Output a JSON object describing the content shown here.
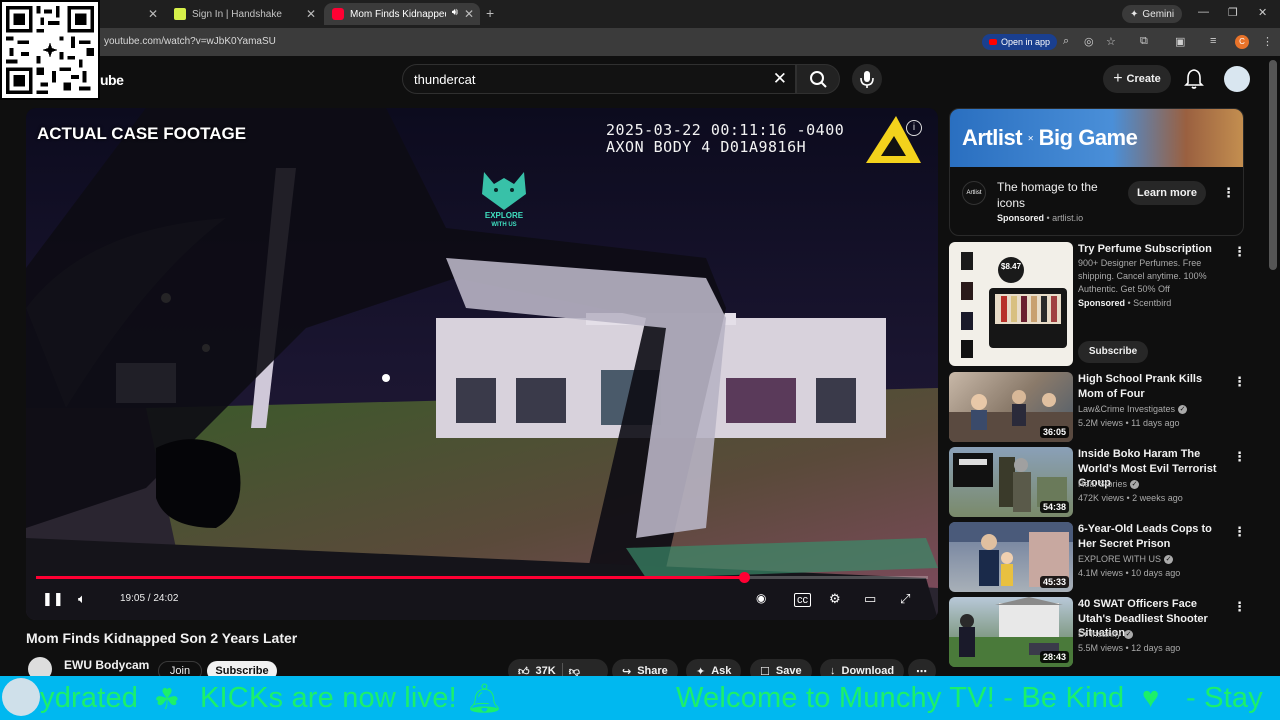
{
  "browser": {
    "tabs": [
      {
        "label": "",
        "active": false
      },
      {
        "label": "Sign In | Handshake",
        "active": false
      },
      {
        "label": "Mom Finds Kidnapped Son",
        "active": true
      }
    ],
    "new_tab": "+",
    "gemini": "Gemini",
    "url": "youtube.com/watch?v=wJbK0YamaSU",
    "open_in_app": "Open in app",
    "profile_initial": "C",
    "minimize": "—",
    "maximize": "❐",
    "close": "✕"
  },
  "youtube": {
    "logo_text": "ube",
    "search_query": "thundercat",
    "create_label": "Create"
  },
  "video": {
    "overlay_left": "ACTUAL CASE FOOTAGE",
    "timestamp_line1": "2025-03-22 00:11:16 -0400",
    "timestamp_line2": "AXON BODY 4 D01A9816H",
    "watermark_line1": "EXPLORE",
    "watermark_line2": "WITH US",
    "current_time": "19:05",
    "duration": "24:02",
    "time_display": "19:05 / 24:02",
    "progress_fraction": 0.794,
    "title": "Mom Finds Kidnapped Son 2 Years Later",
    "channel": "EWU Bodycam",
    "join_label": "Join",
    "subscribe_label": "Subscribe",
    "likes": "37K",
    "share_label": "Share",
    "ask_label": "Ask",
    "save_label": "Save",
    "download_label": "Download"
  },
  "ad": {
    "banner_left": "Artlist",
    "banner_x": "×",
    "banner_right": "Big Game",
    "logo_text": "Artlist",
    "headline": "The homage to the icons",
    "sponsored": "Sponsored",
    "domain": "artlist.io",
    "learn_more": "Learn more"
  },
  "recommendations": [
    {
      "title": "Try Perfume Subscription",
      "desc": "900+ Designer Perfumes. Free shipping. Cancel anytime. 100% Authentic. Get 50% Off",
      "sponsored": "Sponsored",
      "advertiser": "Scentbird",
      "button": "Subscribe",
      "price_badge": "$8.47"
    },
    {
      "title": "High School Prank Kills Mom of Four",
      "channel": "Law&Crime Investigates",
      "meta": "5.2M views • 11 days ago",
      "duration": "36:05"
    },
    {
      "title": "Inside Boko Haram The World's Most Evil Terrorist Group",
      "channel": "Real Stories",
      "meta": "472K views • 2 weeks ago",
      "duration": "54:38"
    },
    {
      "title": "6-Year-Old Leads Cops to Her Secret Prison",
      "channel": "EXPLORE WITH US",
      "meta": "4.1M views • 10 days ago",
      "duration": "45:33"
    },
    {
      "title": "40 SWAT Officers Face Utah's Deadliest Shooter Situation",
      "channel": "Dr Insanity",
      "meta": "5.5M views • 12 days ago",
      "duration": "28:43"
    }
  ],
  "ticker": {
    "segment1": "ydrated",
    "segment2": "KICKs are now live!",
    "segment3": "Welcome to Munchy TV!  - Be Kind",
    "segment4": "- Stay"
  },
  "colors": {
    "yt_red": "#ff0033",
    "ticker_bg": "#00b8f0",
    "ticker_text": "#1cf06a",
    "watermark": "#3fe0c0"
  }
}
